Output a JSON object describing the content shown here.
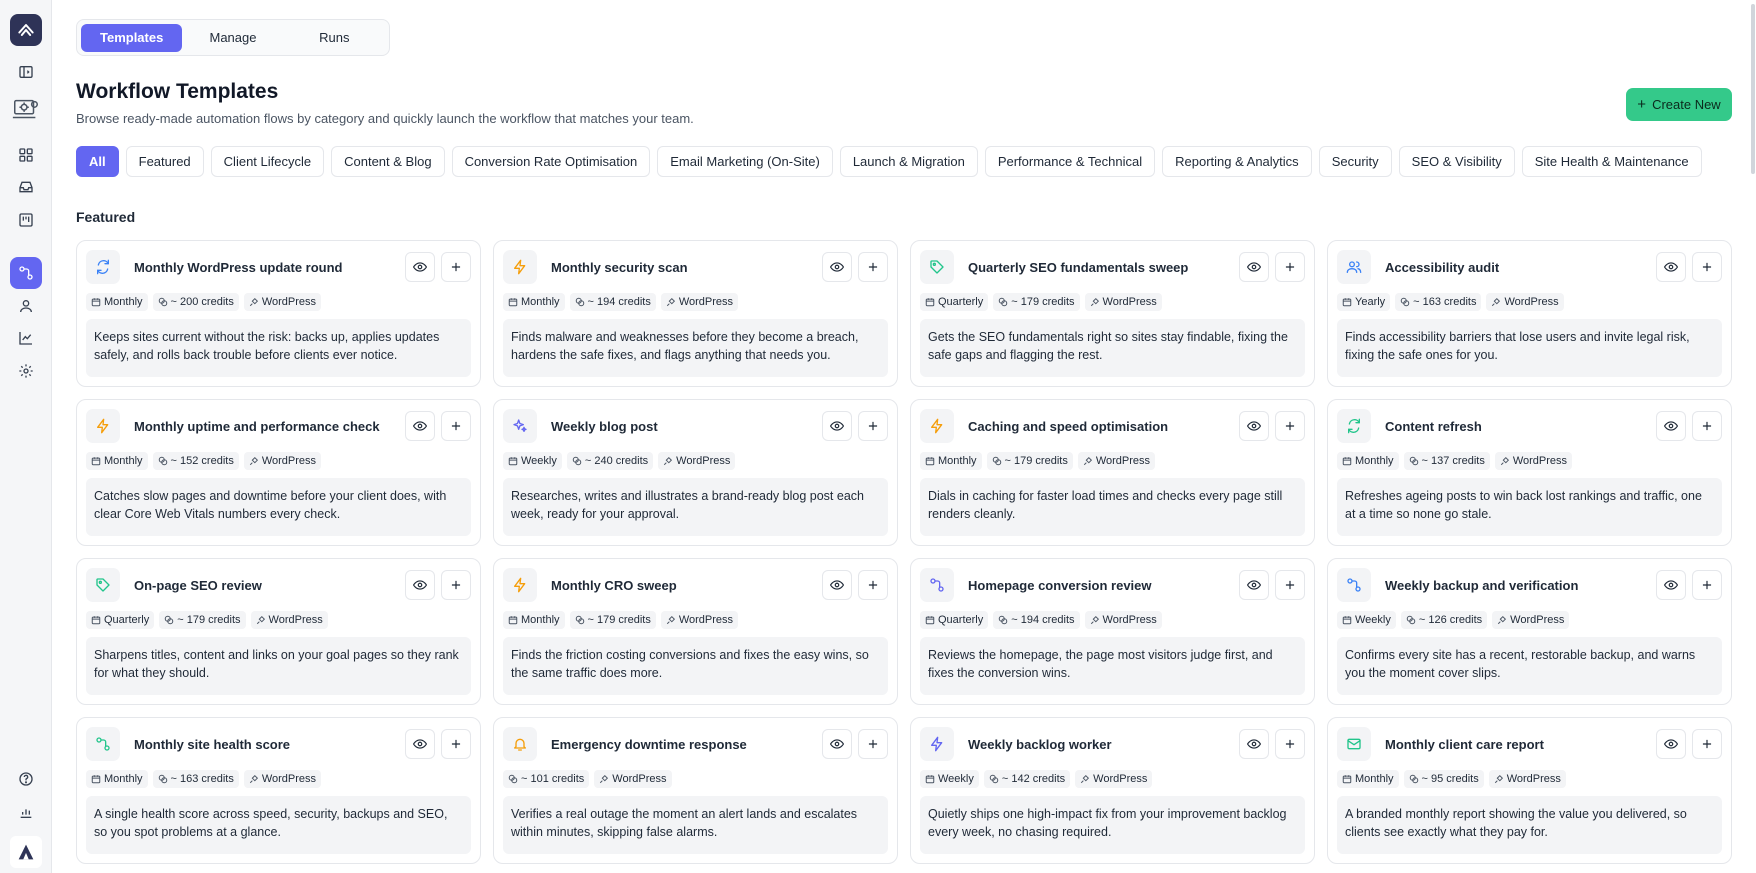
{
  "tabs": [
    {
      "label": "Templates",
      "active": true
    },
    {
      "label": "Manage",
      "active": false
    },
    {
      "label": "Runs",
      "active": false
    }
  ],
  "header": {
    "title": "Workflow Templates",
    "subtitle": "Browse ready-made automation flows by category and quickly launch the workflow that matches your team."
  },
  "create_button": {
    "label": "Create New"
  },
  "categories": [
    {
      "label": "All",
      "active": true
    },
    {
      "label": "Featured"
    },
    {
      "label": "Client Lifecycle"
    },
    {
      "label": "Content & Blog"
    },
    {
      "label": "Conversion Rate Optimisation"
    },
    {
      "label": "Email Marketing (On-Site)"
    },
    {
      "label": "Launch & Migration"
    },
    {
      "label": "Performance & Technical"
    },
    {
      "label": "Reporting & Analytics"
    },
    {
      "label": "Security"
    },
    {
      "label": "SEO & Visibility"
    },
    {
      "label": "Site Health & Maintenance"
    }
  ],
  "section": {
    "title": "Featured"
  },
  "colors": {
    "accent": "#6366f1",
    "create": "#34c98a",
    "blue": "#3b82f6",
    "orange": "#f59e0b",
    "green": "#22c58b",
    "indigo": "#6366f1",
    "teal": "#14b8a6"
  },
  "cards": [
    {
      "title": "Monthly WordPress update round",
      "icon": "refresh-icon",
      "color": "#3b82f6",
      "frequency": "Monthly",
      "credits": "~ 200 credits",
      "platform": "WordPress",
      "description": "Keeps sites current without the risk: backs up, applies updates safely, and rolls back trouble before clients ever notice."
    },
    {
      "title": "Monthly security scan",
      "icon": "bolt-icon",
      "color": "#f59e0b",
      "frequency": "Monthly",
      "credits": "~ 194 credits",
      "platform": "WordPress",
      "description": "Finds malware and weaknesses before they become a breach, hardens the safe fixes, and flags anything that needs you."
    },
    {
      "title": "Quarterly SEO fundamentals sweep",
      "icon": "tag-icon",
      "color": "#22c58b",
      "frequency": "Quarterly",
      "credits": "~ 179 credits",
      "platform": "WordPress",
      "description": "Gets the SEO fundamentals right so sites stay findable, fixing the safe gaps and flagging the rest."
    },
    {
      "title": "Accessibility audit",
      "icon": "users-icon",
      "color": "#3b82f6",
      "frequency": "Yearly",
      "credits": "~ 163 credits",
      "platform": "WordPress",
      "description": "Finds accessibility barriers that lose users and invite legal risk, fixing the safe ones for you."
    },
    {
      "title": "Monthly uptime and performance check",
      "icon": "bolt-icon",
      "color": "#f59e0b",
      "frequency": "Monthly",
      "credits": "~ 152 credits",
      "platform": "WordPress",
      "description": "Catches slow pages and downtime before your client does, with clear Core Web Vitals numbers every check."
    },
    {
      "title": "Weekly blog post",
      "icon": "sparkles-icon",
      "color": "#6366f1",
      "frequency": "Weekly",
      "credits": "~ 240 credits",
      "platform": "WordPress",
      "description": "Researches, writes and illustrates a brand-ready blog post each week, ready for your approval."
    },
    {
      "title": "Caching and speed optimisation",
      "icon": "bolt-icon",
      "color": "#f59e0b",
      "frequency": "Monthly",
      "credits": "~ 179 credits",
      "platform": "WordPress",
      "description": "Dials in caching for faster load times and checks every page still renders cleanly."
    },
    {
      "title": "Content refresh",
      "icon": "refresh-icon",
      "color": "#22c58b",
      "frequency": "Monthly",
      "credits": "~ 137 credits",
      "platform": "WordPress",
      "description": "Refreshes ageing posts to win back lost rankings and traffic, one at a time so none go stale."
    },
    {
      "title": "On-page SEO review",
      "icon": "tag-icon",
      "color": "#22c58b",
      "frequency": "Quarterly",
      "credits": "~ 179 credits",
      "platform": "WordPress",
      "description": "Sharpens titles, content and links on your goal pages so they rank for what they should."
    },
    {
      "title": "Monthly CRO sweep",
      "icon": "bolt-icon",
      "color": "#f59e0b",
      "frequency": "Monthly",
      "credits": "~ 179 credits",
      "platform": "WordPress",
      "description": "Finds the friction costing conversions and fixes the easy wins, so the same traffic does more."
    },
    {
      "title": "Homepage conversion review",
      "icon": "workflow-icon",
      "color": "#6366f1",
      "frequency": "Quarterly",
      "credits": "~ 194 credits",
      "platform": "WordPress",
      "description": "Reviews the homepage, the page most visitors judge first, and fixes the conversion wins."
    },
    {
      "title": "Weekly backup and verification",
      "icon": "workflow-icon",
      "color": "#3b82f6",
      "frequency": "Weekly",
      "credits": "~ 126 credits",
      "platform": "WordPress",
      "description": "Confirms every site has a recent, restorable backup, and warns you the moment cover slips."
    },
    {
      "title": "Monthly site health score",
      "icon": "workflow-icon",
      "color": "#22c58b",
      "frequency": "Monthly",
      "credits": "~ 163 credits",
      "platform": "WordPress",
      "description": "A single health score across speed, security, backups and SEO, so you spot problems at a glance."
    },
    {
      "title": "Emergency downtime response",
      "icon": "bell-icon",
      "color": "#f59e0b",
      "frequency": "",
      "credits": "~ 101 credits",
      "platform": "WordPress",
      "description": "Verifies a real outage the moment an alert lands and escalates within minutes, skipping false alarms."
    },
    {
      "title": "Weekly backlog worker",
      "icon": "bolt-icon",
      "color": "#6366f1",
      "frequency": "Weekly",
      "credits": "~ 142 credits",
      "platform": "WordPress",
      "description": "Quietly ships one high-impact fix from your improvement backlog every week, no chasing required."
    },
    {
      "title": "Monthly client care report",
      "icon": "mail-icon",
      "color": "#22c58b",
      "frequency": "Monthly",
      "credits": "~ 95 credits",
      "platform": "WordPress",
      "description": "A branded monthly report showing the value you delivered, so clients see exactly what they pay for."
    }
  ]
}
